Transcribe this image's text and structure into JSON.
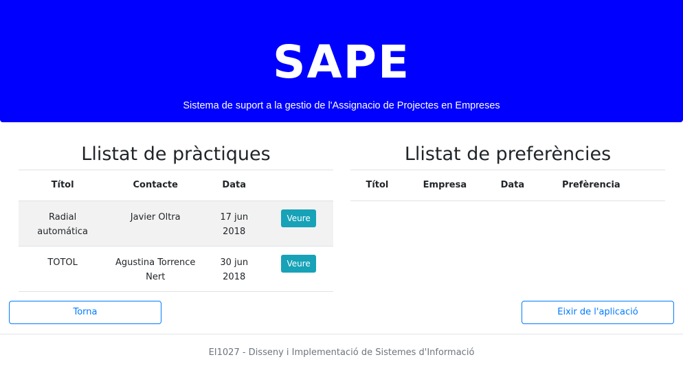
{
  "header": {
    "logo": "SAPE",
    "subtitle": "Sistema de suport a la gestio de l'Assignacio de Projectes en Empreses"
  },
  "practiques": {
    "title": "Llistat de pràctiques",
    "columns": [
      "Títol",
      "Contacte",
      "Data",
      ""
    ],
    "rows": [
      {
        "titol": "Radial automática",
        "contacte": "Javier Oltra",
        "data": "17 jun 2018",
        "button": "Veure"
      },
      {
        "titol": "TOTOL",
        "contacte": "Agustina Torrence Nert",
        "data": "30 jun 2018",
        "button": "Veure"
      }
    ]
  },
  "preferencies": {
    "title": "Llistat de preferències",
    "columns": [
      "Títol",
      "Empresa",
      "Data",
      "Prefèrencia"
    ]
  },
  "actions": {
    "back_label": "Torna",
    "exit_label": "Eixir de l'aplicació"
  },
  "footer": {
    "text": "EI1027 - Disseny i Implementació de Sistemes d'Informació"
  },
  "colors": {
    "header_bg": "#0000ff",
    "info_button": "#17a2b8",
    "primary_outline": "#007bff"
  }
}
